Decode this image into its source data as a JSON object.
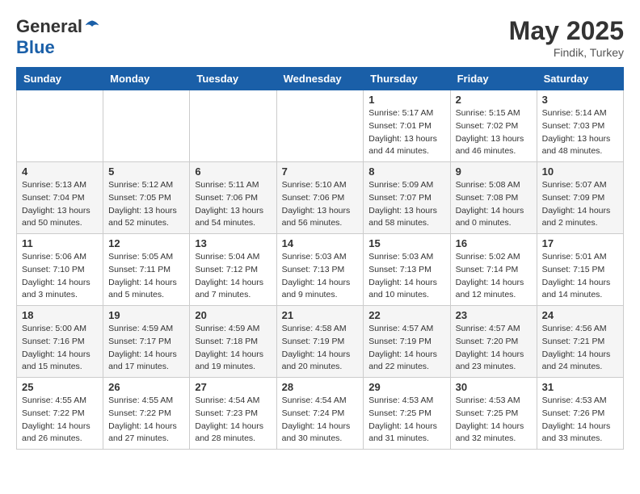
{
  "header": {
    "logo_general": "General",
    "logo_blue": "Blue",
    "month_year": "May 2025",
    "location": "Findik, Turkey"
  },
  "weekdays": [
    "Sunday",
    "Monday",
    "Tuesday",
    "Wednesday",
    "Thursday",
    "Friday",
    "Saturday"
  ],
  "weeks": [
    [
      {
        "day": "",
        "info": ""
      },
      {
        "day": "",
        "info": ""
      },
      {
        "day": "",
        "info": ""
      },
      {
        "day": "",
        "info": ""
      },
      {
        "day": "1",
        "info": "Sunrise: 5:17 AM\nSunset: 7:01 PM\nDaylight: 13 hours\nand 44 minutes."
      },
      {
        "day": "2",
        "info": "Sunrise: 5:15 AM\nSunset: 7:02 PM\nDaylight: 13 hours\nand 46 minutes."
      },
      {
        "day": "3",
        "info": "Sunrise: 5:14 AM\nSunset: 7:03 PM\nDaylight: 13 hours\nand 48 minutes."
      }
    ],
    [
      {
        "day": "4",
        "info": "Sunrise: 5:13 AM\nSunset: 7:04 PM\nDaylight: 13 hours\nand 50 minutes."
      },
      {
        "day": "5",
        "info": "Sunrise: 5:12 AM\nSunset: 7:05 PM\nDaylight: 13 hours\nand 52 minutes."
      },
      {
        "day": "6",
        "info": "Sunrise: 5:11 AM\nSunset: 7:06 PM\nDaylight: 13 hours\nand 54 minutes."
      },
      {
        "day": "7",
        "info": "Sunrise: 5:10 AM\nSunset: 7:06 PM\nDaylight: 13 hours\nand 56 minutes."
      },
      {
        "day": "8",
        "info": "Sunrise: 5:09 AM\nSunset: 7:07 PM\nDaylight: 13 hours\nand 58 minutes."
      },
      {
        "day": "9",
        "info": "Sunrise: 5:08 AM\nSunset: 7:08 PM\nDaylight: 14 hours\nand 0 minutes."
      },
      {
        "day": "10",
        "info": "Sunrise: 5:07 AM\nSunset: 7:09 PM\nDaylight: 14 hours\nand 2 minutes."
      }
    ],
    [
      {
        "day": "11",
        "info": "Sunrise: 5:06 AM\nSunset: 7:10 PM\nDaylight: 14 hours\nand 3 minutes."
      },
      {
        "day": "12",
        "info": "Sunrise: 5:05 AM\nSunset: 7:11 PM\nDaylight: 14 hours\nand 5 minutes."
      },
      {
        "day": "13",
        "info": "Sunrise: 5:04 AM\nSunset: 7:12 PM\nDaylight: 14 hours\nand 7 minutes."
      },
      {
        "day": "14",
        "info": "Sunrise: 5:03 AM\nSunset: 7:13 PM\nDaylight: 14 hours\nand 9 minutes."
      },
      {
        "day": "15",
        "info": "Sunrise: 5:03 AM\nSunset: 7:13 PM\nDaylight: 14 hours\nand 10 minutes."
      },
      {
        "day": "16",
        "info": "Sunrise: 5:02 AM\nSunset: 7:14 PM\nDaylight: 14 hours\nand 12 minutes."
      },
      {
        "day": "17",
        "info": "Sunrise: 5:01 AM\nSunset: 7:15 PM\nDaylight: 14 hours\nand 14 minutes."
      }
    ],
    [
      {
        "day": "18",
        "info": "Sunrise: 5:00 AM\nSunset: 7:16 PM\nDaylight: 14 hours\nand 15 minutes."
      },
      {
        "day": "19",
        "info": "Sunrise: 4:59 AM\nSunset: 7:17 PM\nDaylight: 14 hours\nand 17 minutes."
      },
      {
        "day": "20",
        "info": "Sunrise: 4:59 AM\nSunset: 7:18 PM\nDaylight: 14 hours\nand 19 minutes."
      },
      {
        "day": "21",
        "info": "Sunrise: 4:58 AM\nSunset: 7:19 PM\nDaylight: 14 hours\nand 20 minutes."
      },
      {
        "day": "22",
        "info": "Sunrise: 4:57 AM\nSunset: 7:19 PM\nDaylight: 14 hours\nand 22 minutes."
      },
      {
        "day": "23",
        "info": "Sunrise: 4:57 AM\nSunset: 7:20 PM\nDaylight: 14 hours\nand 23 minutes."
      },
      {
        "day": "24",
        "info": "Sunrise: 4:56 AM\nSunset: 7:21 PM\nDaylight: 14 hours\nand 24 minutes."
      }
    ],
    [
      {
        "day": "25",
        "info": "Sunrise: 4:55 AM\nSunset: 7:22 PM\nDaylight: 14 hours\nand 26 minutes."
      },
      {
        "day": "26",
        "info": "Sunrise: 4:55 AM\nSunset: 7:22 PM\nDaylight: 14 hours\nand 27 minutes."
      },
      {
        "day": "27",
        "info": "Sunrise: 4:54 AM\nSunset: 7:23 PM\nDaylight: 14 hours\nand 28 minutes."
      },
      {
        "day": "28",
        "info": "Sunrise: 4:54 AM\nSunset: 7:24 PM\nDaylight: 14 hours\nand 30 minutes."
      },
      {
        "day": "29",
        "info": "Sunrise: 4:53 AM\nSunset: 7:25 PM\nDaylight: 14 hours\nand 31 minutes."
      },
      {
        "day": "30",
        "info": "Sunrise: 4:53 AM\nSunset: 7:25 PM\nDaylight: 14 hours\nand 32 minutes."
      },
      {
        "day": "31",
        "info": "Sunrise: 4:53 AM\nSunset: 7:26 PM\nDaylight: 14 hours\nand 33 minutes."
      }
    ]
  ]
}
